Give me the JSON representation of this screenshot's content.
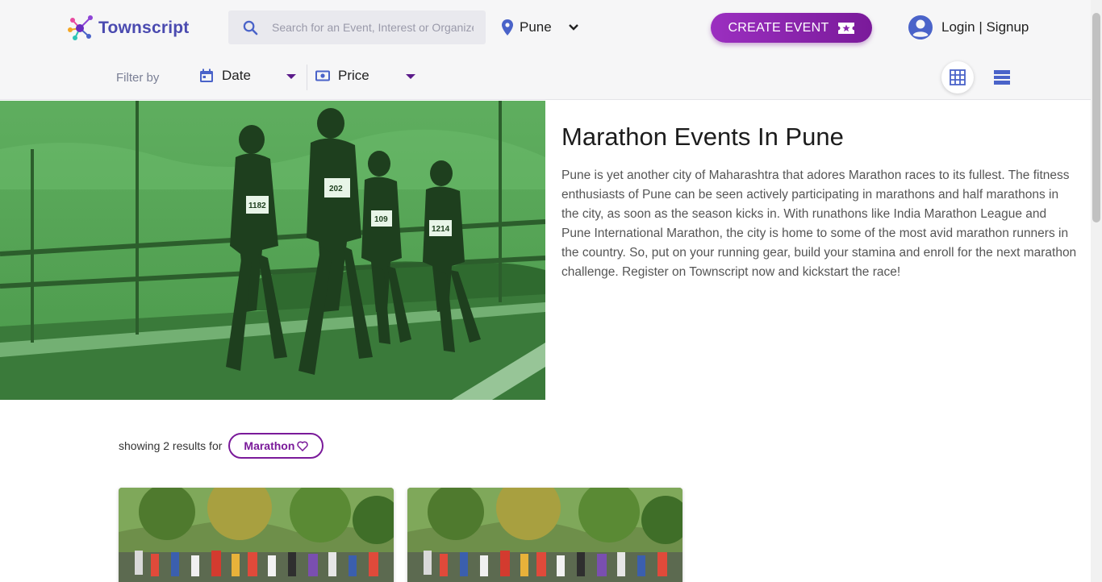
{
  "header": {
    "logo_text": "Townscript",
    "search_placeholder": "Search for an Event, Interest or Organizer",
    "city": "Pune",
    "create_event_label": "CREATE EVENT",
    "login_label": "Login | Signup"
  },
  "filters": {
    "label": "Filter by",
    "date_label": "Date",
    "price_label": "Price"
  },
  "hero": {
    "title": "Marathon Events In Pune",
    "description": "Pune is yet another city of Maharashtra that adores Marathon races to its fullest. The fitness enthusiasts of Pune can be seen actively participating in marathons and half marathons in the city, as soon as the season kicks in. With runathons like India Marathon League and Pune International Marathon, the city is home to some of the most avid marathon runners in the country. So, put on your running gear, build your stamina and enroll for the next marathon challenge. Register on Townscript now and kickstart the race!",
    "runner_bibs": [
      "1182",
      "202",
      "109",
      "1214"
    ]
  },
  "results": {
    "text": "showing 2 results for",
    "tag": "Marathon"
  },
  "colors": {
    "brand_purple": "#7a1a9a",
    "hero_green": "#3f8a3f",
    "icon_blue": "#4a63c9"
  }
}
